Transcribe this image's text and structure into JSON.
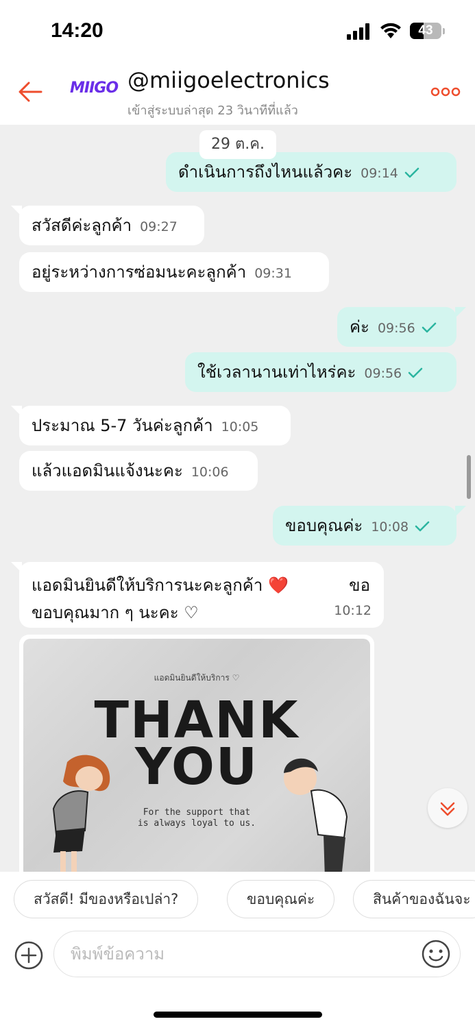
{
  "status_bar": {
    "time": "14:20",
    "battery": 43
  },
  "header": {
    "logo_text": "MIIGO",
    "shop_name": "@miigoelectronics",
    "last_seen": "เข้าสู่ระบบล่าสุด 23 วินาทีที่แล้ว",
    "accent_color": "#ee4d2d"
  },
  "chat": {
    "date_label": "29 ต.ค.",
    "messages": [
      {
        "direction": "out",
        "text": "ดำเนินการถึงไหนแล้วคะ",
        "time": "09:14",
        "read": true
      },
      {
        "direction": "in",
        "text": "สวัสดีค่ะลูกค้า",
        "time": "09:27"
      },
      {
        "direction": "in",
        "text": "อยู่ระหว่างการซ่อมนะคะลูกค้า",
        "time": "09:31"
      },
      {
        "direction": "out",
        "text": "ค่ะ",
        "time": "09:56",
        "read": true
      },
      {
        "direction": "out",
        "text": "ใช้เวลานานเท่าไหร่คะ",
        "time": "09:56",
        "read": true
      },
      {
        "direction": "in",
        "text": "ประมาณ 5-7 วันค่ะลูกค้า",
        "time": "10:05"
      },
      {
        "direction": "in",
        "text": "แล้วแอดมินแจ้งนะคะ",
        "time": "10:06"
      },
      {
        "direction": "out",
        "text": "ขอบคุณค่ะ",
        "time": "10:08",
        "read": true
      },
      {
        "direction": "in",
        "line1": "แอดมินยินดีให้บริการนะคะลูกค้า ❤️",
        "line1_tail": "ขอ",
        "line2": "ขอบคุณมาก ๆ นะคะ ♡",
        "time": "10:12"
      }
    ],
    "image": {
      "small_text": "แอดมินยินดีให้บริการ ♡",
      "title_line1": "THANK",
      "title_line2": "YOU",
      "caption_line1": "For the support that",
      "caption_line2": "is always loyal to us."
    }
  },
  "quick_replies": [
    "สวัสดี! มีของหรือเปล่า?",
    "ขอบคุณค่ะ",
    "สินค้าของฉันจะ"
  ],
  "composer": {
    "placeholder": "พิมพ์ข้อความ"
  }
}
